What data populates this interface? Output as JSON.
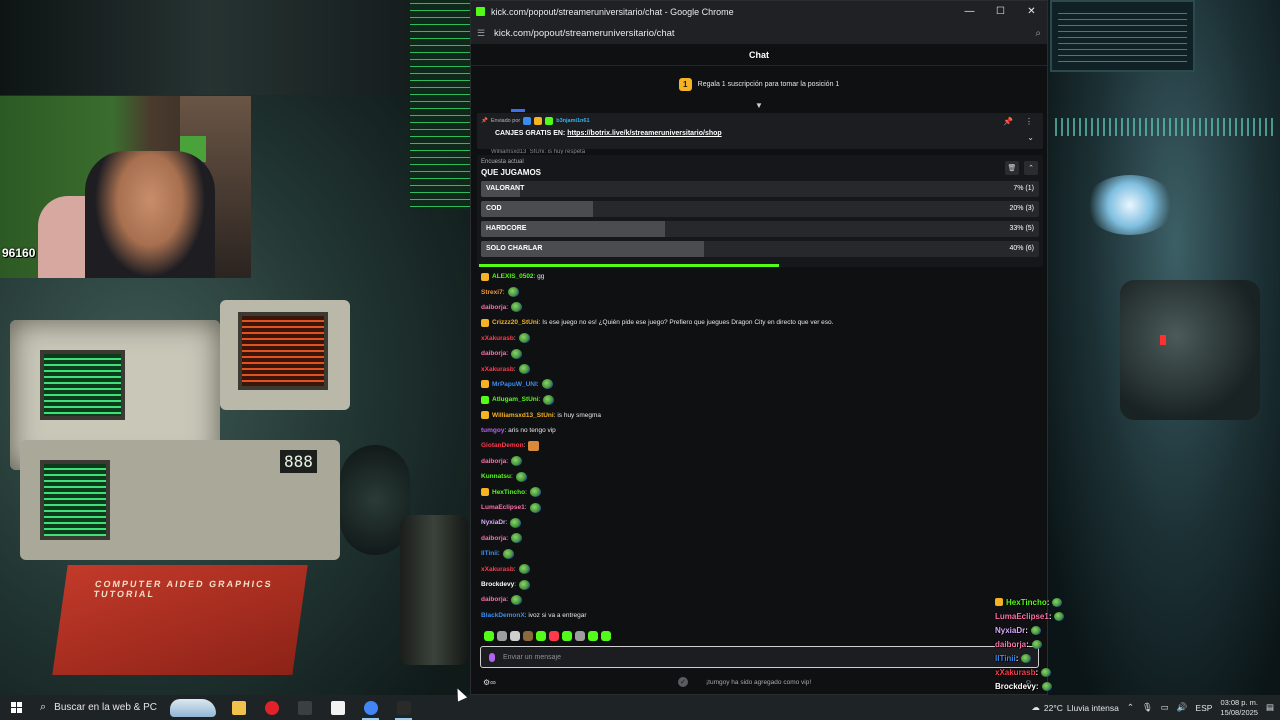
{
  "window": {
    "title": "kick.com/popout/streameruniversitario/chat - Google Chrome",
    "url": "kick.com/popout/streameruniversitario/chat",
    "minimize": "—",
    "maximize": "☐",
    "close": "✕"
  },
  "chat": {
    "header": "Chat",
    "gift_rank": "1",
    "gift_text": "Regala 1 suscripción para tomar la posición 1",
    "pinned": {
      "sent_by": "Enviado por",
      "username": "b3njami1n61",
      "message_prefix": "CANJES GRATIS EN:",
      "link": "https://botrix.live/k/streameruniversitario/shop",
      "peek_text": "Williamsxd13_StUni: is huy respeta"
    },
    "poll": {
      "caption": "Encuesta actual",
      "question": "QUE JUGAMOS",
      "options": [
        {
          "label": "VALORANT",
          "result": "7% (1)",
          "percent": 7
        },
        {
          "label": "COD",
          "result": "20% (3)",
          "percent": 20
        },
        {
          "label": "HARDCORE",
          "result": "33% (5)",
          "percent": 33
        },
        {
          "label": "SOLO CHARLAR",
          "result": "40% (6)",
          "percent": 40
        }
      ],
      "time_remaining_fraction": 0.53
    },
    "messages": [
      {
        "user": "ALEXIS_0502",
        "color": "#53fc18",
        "badge": "#f5b324",
        "text": ": gg",
        "emote": false
      },
      {
        "user": "Strexi7",
        "color": "#f0973a",
        "badge": "",
        "text": ":",
        "emote": true
      },
      {
        "user": "daiborja",
        "color": "#ff6fa8",
        "badge": "",
        "text": ":",
        "emote": true
      },
      {
        "user": "Crizzz20_StUni",
        "color": "#f5b324",
        "badge": "#f5b324",
        "text": ": Is ese juego no es! ¿Quién pide ese juego? Prefiero que juegues Dragon City en directo que ver eso.",
        "emote": false
      },
      {
        "user": "xXakurasb",
        "color": "#ff3a4c",
        "badge": "",
        "text": ":",
        "emote": true
      },
      {
        "user": "daiborja",
        "color": "#ff6fa8",
        "badge": "",
        "text": ":",
        "emote": true
      },
      {
        "user": "xXakurasb",
        "color": "#ff3a4c",
        "badge": "",
        "text": ":",
        "emote": true
      },
      {
        "user": "MrPapuW_UNI",
        "color": "#3a8df0",
        "badge": "#f5b324",
        "text": ":",
        "emote": true
      },
      {
        "user": "Atlugam_StUni",
        "color": "#53fc18",
        "badge": "#53fc18",
        "text": ":",
        "emote": true
      },
      {
        "user": "Williamsxd13_StUni",
        "color": "#f5b324",
        "badge": "#f5b324",
        "text": ": is huy smegma",
        "emote": false
      },
      {
        "user": "tumgoy",
        "color": "#b164f0",
        "badge": "",
        "text": ": aris no tengo vip",
        "emote": false
      },
      {
        "user": "GiotanDemon",
        "color": "#ff3a4c",
        "badge": "",
        "text": ":",
        "emote": "box"
      },
      {
        "user": "daiborja",
        "color": "#ff6fa8",
        "badge": "",
        "text": ":",
        "emote": true
      },
      {
        "user": "Kunnatsu",
        "color": "#53fc18",
        "badge": "",
        "text": ":",
        "emote": true
      },
      {
        "user": "HexTincho",
        "color": "#53fc18",
        "badge": "#f5b324",
        "text": ":",
        "emote": true
      },
      {
        "user": "LumaEclipse1",
        "color": "#ff6fa8",
        "badge": "",
        "text": ":",
        "emote": true
      },
      {
        "user": "NyxiaDr",
        "color": "#d9a8ff",
        "badge": "",
        "text": ":",
        "emote": true
      },
      {
        "user": "daiborja",
        "color": "#ff6fa8",
        "badge": "",
        "text": ":",
        "emote": true
      },
      {
        "user": "IlTinii",
        "color": "#3a8df0",
        "badge": "",
        "text": ":",
        "emote": true
      },
      {
        "user": "xXakurasb",
        "color": "#ff3a4c",
        "badge": "",
        "text": ":",
        "emote": true
      },
      {
        "user": "Brockdevy",
        "color": "#ffffff",
        "badge": "",
        "text": ":",
        "emote": true
      },
      {
        "user": "daiborja",
        "color": "#ff6fa8",
        "badge": "",
        "text": ":",
        "emote": true
      },
      {
        "user": "BlackDemonX",
        "color": "#3a8df0",
        "badge": "",
        "text": ": ivoz si va a entregar",
        "emote": false
      }
    ],
    "emote_bar_colors": [
      "#53fc18",
      "#9e9e9e",
      "#cfcfcf",
      "#8a6a3a",
      "#53fc18",
      "#ff3a4c",
      "#53fc18",
      "#9e9e9e",
      "#53fc18",
      "#53fc18"
    ],
    "input_placeholder": "Enviar un mensaje",
    "tools_icon": "⚙∞",
    "notice": "¡tumgoy ha sido agregado como vip!",
    "send_icon": "☺"
  },
  "overlay": [
    {
      "user": "HexTincho",
      "color": "#53fc18",
      "badge": "#f5b324",
      "text": " :"
    },
    {
      "user": "LumaEclipse1",
      "color": "#ff6fa8",
      "badge": "",
      "text": " :"
    },
    {
      "user": "NyxiaDr",
      "color": "#d9a8ff",
      "badge": "",
      "text": " :"
    },
    {
      "user": "daiborja",
      "color": "#ff6fa8",
      "badge": "",
      "text": " :"
    },
    {
      "user": "IlTinii",
      "color": "#3a8df0",
      "badge": "",
      "text": " :"
    },
    {
      "user": "xXakurasb",
      "color": "#ff3a4c",
      "badge": "",
      "text": " :"
    },
    {
      "user": "Brockdevy",
      "color": "#ffffff",
      "badge": "",
      "text": " :"
    },
    {
      "user": "daiborja",
      "color": "#ff6fa8",
      "badge": "",
      "text": " :"
    },
    {
      "user": "BlackDemonX",
      "color": "#3a8df0",
      "badge": "",
      "text": " : ivoz si va a entregar"
    }
  ],
  "webcam": {
    "counter": "96160"
  },
  "wallpaper": {
    "book_title": "COMPUTER AIDED GRAPHICS TUTORIAL",
    "seg_display": "888"
  },
  "taskbar": {
    "search_placeholder": "Buscar en la web & PC",
    "weather_temp": "22°C",
    "weather_text": "Lluvia intensa",
    "language": "ESP",
    "time": "03:08 p. m.",
    "date": "15/08/2025",
    "apps": [
      {
        "name": "file-explorer",
        "color": "#f0c24b",
        "active": false
      },
      {
        "name": "opera",
        "color": "#e0222b",
        "active": false
      },
      {
        "name": "multitasking",
        "color": "#3a3f44",
        "active": false
      },
      {
        "name": "notepad",
        "color": "#f2f2f2",
        "active": false
      },
      {
        "name": "chrome",
        "color": "#4285f4",
        "active": true
      },
      {
        "name": "obs",
        "color": "#2a2a2a",
        "active": true
      }
    ]
  }
}
